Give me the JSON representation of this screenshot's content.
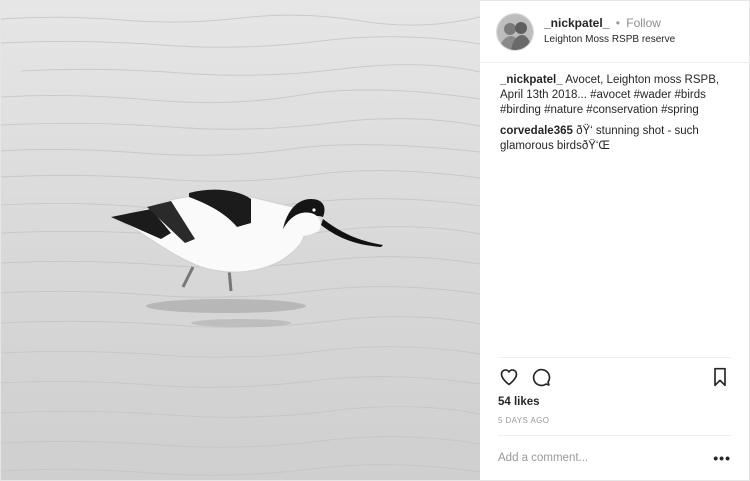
{
  "post": {
    "username": "_nickpatel_",
    "separator": "•",
    "follow_label": "Follow",
    "location": "Leighton Moss RSPB reserve"
  },
  "comments": [
    {
      "user": "_nickpatel_",
      "text": "Avocet, Leighton moss RSPB, April 13th 2018... #avocet #wader #birds #birding #nature #conservation #spring"
    },
    {
      "user": "corvedale365",
      "text": "ðŸ‘ stunning shot - such glamorous birdsðŸ‘Œ"
    }
  ],
  "likes_label": "54 likes",
  "time_ago": "5 DAYS AGO",
  "add_comment_placeholder": "Add a comment...",
  "more_label": "•••",
  "icons": {
    "like": "heart-icon",
    "comment": "comment-icon",
    "save": "bookmark-icon",
    "options": "more-options-icon"
  }
}
